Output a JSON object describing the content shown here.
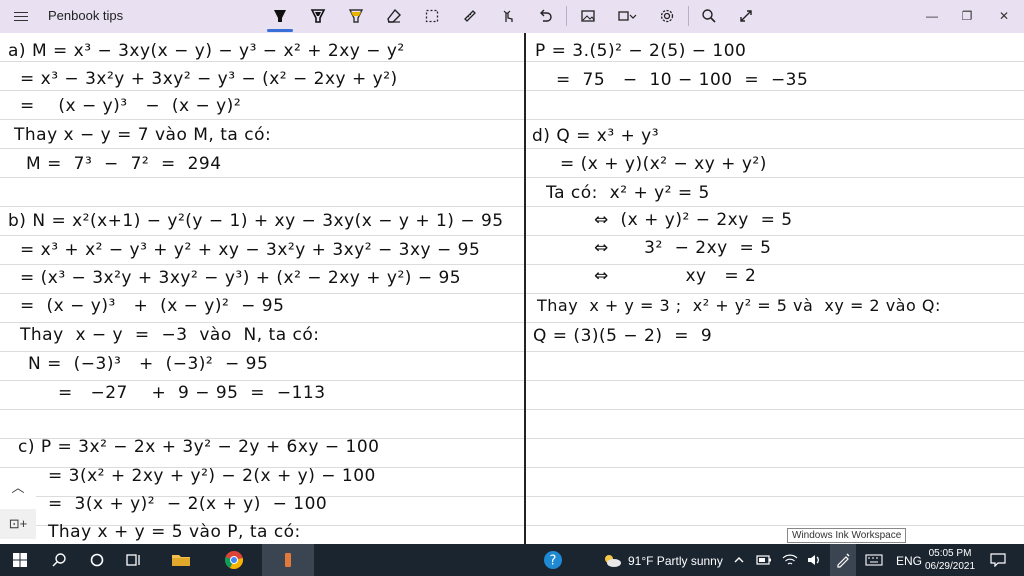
{
  "window": {
    "title": "Penbook tips",
    "controls": {
      "minimize": "—",
      "restore": "❐",
      "close": "✕"
    }
  },
  "toolbar": {
    "tools": [
      "pen-tool",
      "pencil-tool",
      "highlighter-tool",
      "eraser-tool",
      "lasso-select-tool",
      "ruler-tool",
      "touch-writing-tool",
      "undo-tool",
      "insert-image-tool",
      "shapes-tool",
      "settings-tool",
      "zoom-tool",
      "expand-tool"
    ],
    "selected_tool": "pen-tool"
  },
  "notebook": {
    "left_page": [
      "a) M = x³ − 3xy(x − y) − y³ − x² + 2xy − y²",
      "= x³ − 3x²y + 3xy² − y³ − (x² − 2xy + y²)",
      "=    (x − y)³   −  (x − y)²",
      "Thay x − y = 7 vào M, ta có:",
      "M =  7³  −  7²  =  294",
      "b) N = x²(x+1) − y²(y − 1) + xy − 3xy(x − y + 1) − 95",
      "= x³ + x² − y³ + y² + xy − 3x²y + 3xy² − 3xy − 95",
      "= (x³ − 3x²y + 3xy² − y³) + (x² − 2xy + y²) − 95",
      "=  (x − y)³   +  (x − y)²  − 95",
      "Thay  x − y  =  −3  vào  N, ta có:",
      "N =  (−3)³   +  (−3)²  − 95",
      "=   −27    +  9 − 95  =  −113",
      "c) P = 3x² − 2x + 3y² − 2y + 6xy − 100",
      "= 3(x² + 2xy + y²) − 2(x + y) − 100",
      "=  3(x + y)²  − 2(x + y)  − 100",
      "Thay x + y = 5 vào P, ta có:"
    ],
    "right_page": [
      "P = 3.(5)² − 2(5) − 100",
      "=  75   −  10 − 100  =  −35",
      "d) Q = x³ + y³",
      "= (x + y)(x² − xy + y²)",
      "Ta có:  x² + y² = 5",
      "⇔  (x + y)² − 2xy  = 5",
      "⇔      3²  − 2xy  = 5",
      "⇔             xy   = 2",
      "Thay  x + y = 3 ;  x² + y² = 5 và  xy = 2 vào Q:",
      "Q = (3)(5 − 2)  =  9"
    ]
  },
  "side_controls": {
    "collapse": "︿",
    "page_button": "⊡+"
  },
  "tooltip": "Windows Ink Workspace",
  "taskbar": {
    "weather": "91°F  Partly sunny",
    "language": "ENG",
    "time": "05:05 PM",
    "date": "06/29/2021"
  },
  "colors": {
    "titlebar": "#e9e1f2",
    "accent": "#3a6fd8",
    "taskbar": "#1b2530",
    "highlighter": "#e8b400"
  }
}
